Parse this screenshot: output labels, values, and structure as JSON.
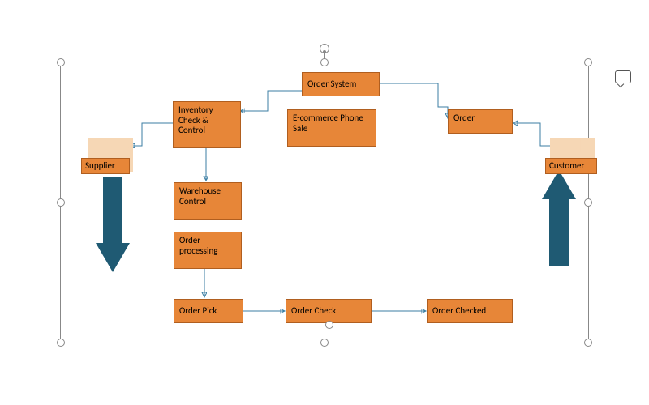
{
  "boxes": {
    "order_system": "Order System",
    "inventory": "Inventory Check & Control",
    "ecommerce": "E-commerce Phone Sale",
    "order": "Order",
    "supplier": "Supplier",
    "customer": "Customer",
    "warehouse": "Warehouse Control",
    "order_processing": "Order processing",
    "order_pick": "Order Pick",
    "order_check": "Order Check",
    "order_checked": "Order Checked"
  },
  "colors": {
    "box_fill": "#e78638",
    "box_border": "#b05e1f",
    "factory": "#f6d7b5",
    "big_arrow": "#1f5a73",
    "connector": "#3b7ea3"
  }
}
